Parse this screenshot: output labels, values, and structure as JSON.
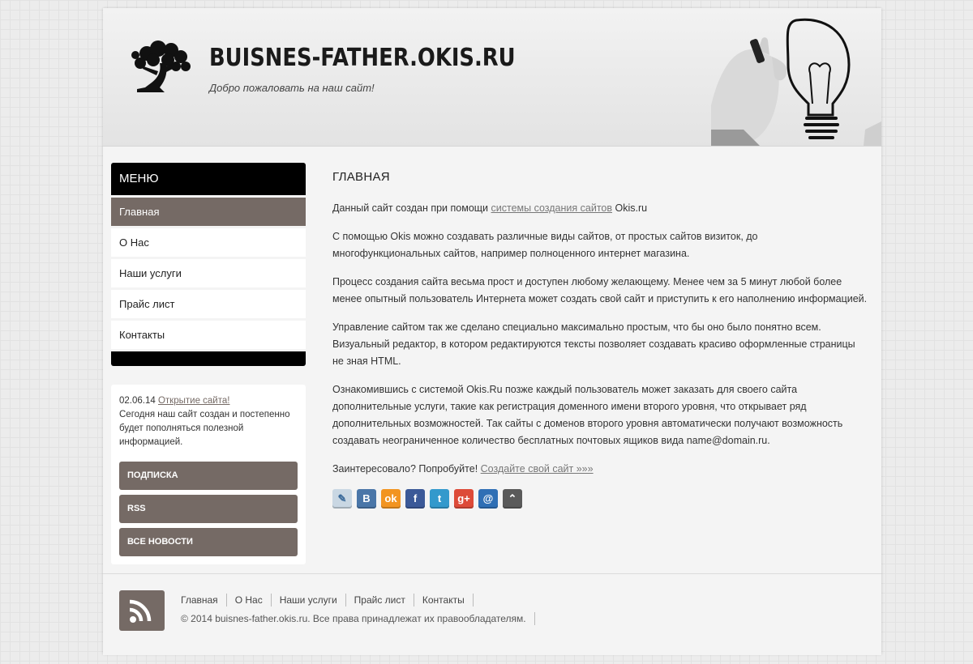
{
  "header": {
    "title": "BUISNES-FATHER.OKIS.RU",
    "slogan": "Добро пожаловать на наш сайт!"
  },
  "sidebar": {
    "menu_title": "МЕНЮ",
    "items": [
      {
        "label": "Главная",
        "active": true
      },
      {
        "label": "О Нас"
      },
      {
        "label": "Наши услуги"
      },
      {
        "label": "Прайс лист"
      },
      {
        "label": "Контакты"
      }
    ],
    "news": {
      "date": "02.06.14",
      "link": "Открытие сайта!",
      "text": "Сегодня наш сайт создан и постепенно будет пополняться полезной информацией."
    },
    "buttons": [
      "ПОДПИСКА",
      "RSS",
      "ВСЕ НОВОСТИ"
    ]
  },
  "main": {
    "heading": "ГЛАВНАЯ",
    "p1_before": "Данный сайт создан при помощи",
    "p1_link": "системы создания сайтов",
    "p1_after": "Okis.ru",
    "p2": "С помощью Okis можно создавать различные виды сайтов, от простых сайтов визиток, до многофункциональных сайтов, например полноценного интернет магазина.",
    "p3": "Процесс создания сайта весьма прост и доступен любому желающему. Менее чем за 5 минут любой более менее опытный пользователь Интернета может создать свой сайт и приступить к его наполнению информацией.",
    "p4": "Управление сайтом так же сделано специально максимально простым, что бы оно было понятно всем. Визуальный редактор, в котором редактируются тексты позволяет создавать красиво оформленные страницы не зная HTML.",
    "p5": "Ознакомившись с системой Okis.Ru позже каждый пользователь может заказать для своего сайта дополнительные услуги, такие как регистрация доменного имени второго уровня, что открывает ряд дополнительных возможностей. Так сайты с доменов второго уровня автоматически получают возможность создавать неограниченное количество бесплатных почтовых ящиков вида name@domain.ru.",
    "p6_before": "Заинтересовало? Попробуйте!",
    "p6_link": "Создайте свой сайт »»»"
  },
  "share": [
    {
      "icon": "livejournal-icon",
      "glyph": "✎",
      "color": "#c9d7e3"
    },
    {
      "icon": "vkontakte-icon",
      "glyph": "В",
      "color": "#4a76a8"
    },
    {
      "icon": "odnoklassniki-icon",
      "glyph": "ok",
      "color": "#f29420"
    },
    {
      "icon": "facebook-icon",
      "glyph": "f",
      "color": "#3b5998"
    },
    {
      "icon": "twitter-icon",
      "glyph": "t",
      "color": "#3399cc"
    },
    {
      "icon": "googleplus-icon",
      "glyph": "g+",
      "color": "#dd4b39"
    },
    {
      "icon": "mailru-icon",
      "glyph": "@",
      "color": "#2f6fb5"
    },
    {
      "icon": "more-icon",
      "glyph": "⌃",
      "color": "#5a5a5a"
    }
  ],
  "footer": {
    "links": [
      "Главная",
      "О Нас",
      "Наши услуги",
      "Прайс лист",
      "Контакты"
    ],
    "copyright": "© 2014 buisnes-father.okis.ru. Все права принадлежат их правообладателям."
  },
  "colors": {
    "accent": "#756a65",
    "menu_header": "#000000"
  }
}
